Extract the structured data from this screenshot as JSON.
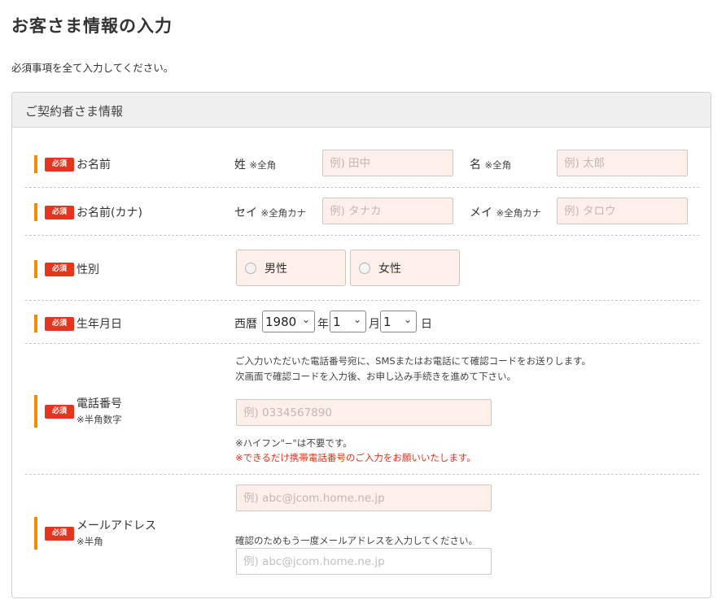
{
  "page": {
    "title": "お客さま情報の入力",
    "lead": "必須事項を全て入力してください。"
  },
  "panel": {
    "title": "ご契約者さま情報"
  },
  "required_badge": "必須",
  "rows": {
    "name": {
      "label": "お名前",
      "last_label": "姓",
      "last_note": "※全角",
      "last_placeholder": "例) 田中",
      "first_label": "名",
      "first_note": "※全角",
      "first_placeholder": "例) 太郎"
    },
    "kana": {
      "label": "お名前(カナ)",
      "last_label": "セイ",
      "last_note": "※全角カナ",
      "last_placeholder": "例) タナカ",
      "first_label": "メイ",
      "first_note": "※全角カナ",
      "first_placeholder": "例) タロウ"
    },
    "gender": {
      "label": "性別",
      "options": [
        "男性",
        "女性"
      ]
    },
    "birthdate": {
      "label": "生年月日",
      "era_label": "西暦",
      "year_value": "1980",
      "year_unit": "年",
      "month_value": "1",
      "month_unit": "月",
      "day_value": "1",
      "day_unit": "日"
    },
    "phone": {
      "label": "電話番号",
      "sub": "※半角数字",
      "note1": "ご入力いただいた電話番号宛に、SMSまたはお電話にて確認コードをお送りします。",
      "note2": "次画面で確認コードを入力後、お申し込み手続きを進めて下さい。",
      "placeholder": "例) 0334567890",
      "hint": "※ハイフン\"−\"は不要です。",
      "warning": "※できるだけ携帯電話番号のご入力をお願いいたします。"
    },
    "email": {
      "label": "メールアドレス",
      "sub": "※半角",
      "placeholder": "例) abc@jcom.home.ne.jp",
      "confirm_note": "確認のためもう一度メールアドレスを入力してください。",
      "confirm_placeholder": "例) abc@jcom.home.ne.jp"
    }
  },
  "colors": {
    "accent_bar": "#f08c00",
    "required_badge": "#e4351e",
    "input_bg": "#fdefea",
    "warning_text": "#e4351e"
  }
}
